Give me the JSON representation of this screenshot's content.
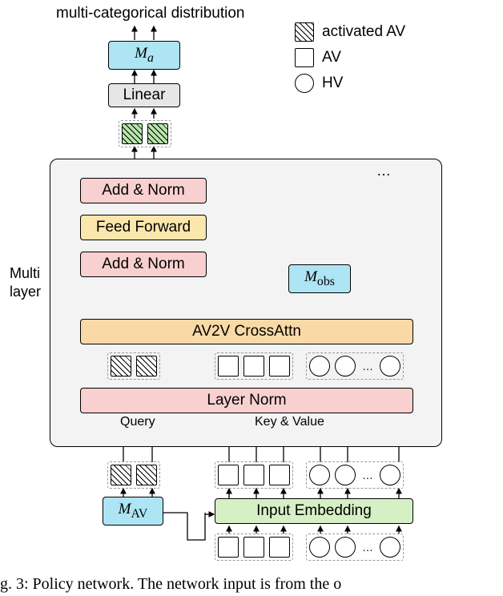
{
  "title": "multi-categorical distribution",
  "blocks": {
    "ma": "M",
    "ma_sub": "a",
    "linear": "Linear",
    "addnorm1": "Add & Norm",
    "feedforward": "Feed Forward",
    "addnorm2": "Add & Norm",
    "mobs": "M",
    "mobs_sub": "obs",
    "crossattn": "AV2V CrossAttn",
    "layernorm": "Layer Norm",
    "mav": "M",
    "mav_sub": "AV",
    "inputemb": "Input Embedding"
  },
  "labels": {
    "multilayer1": "Multi",
    "multilayer2": "layer",
    "query": "Query",
    "keyvalue": "Key & Value",
    "ellipsis": "…"
  },
  "legend": {
    "activated": "activated AV",
    "av": "AV",
    "hv": "HV"
  },
  "caption": "g. 3: Policy network. The network input is from the o"
}
